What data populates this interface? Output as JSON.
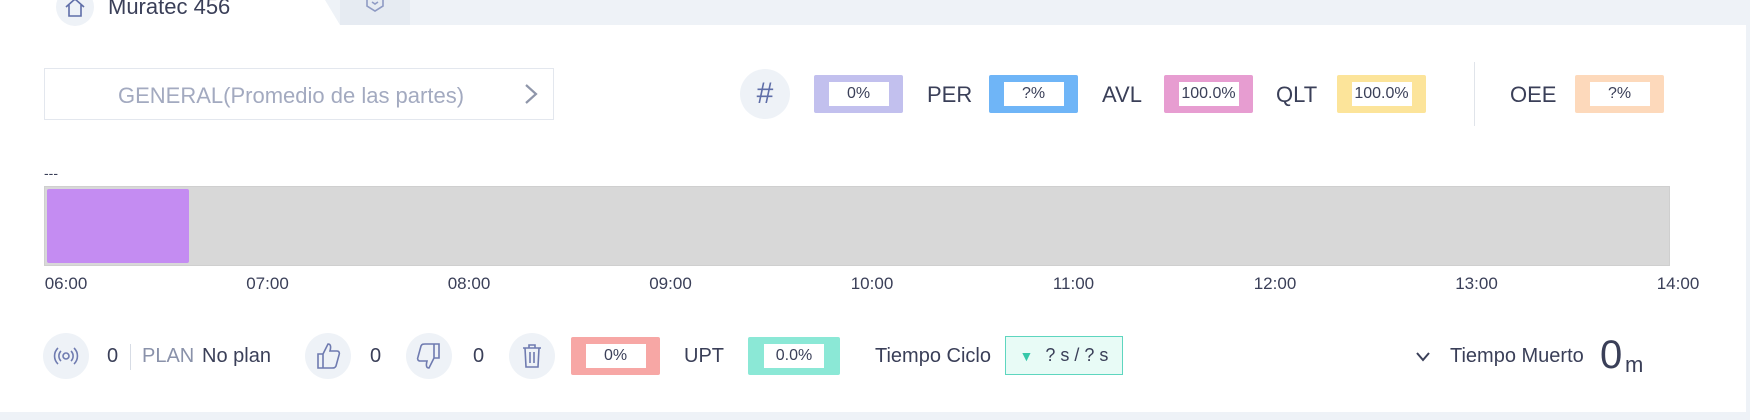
{
  "tabs": [
    {
      "label": "Muratec 456",
      "icon": "home-icon"
    },
    {
      "label": "",
      "icon": "hexagon-icon"
    }
  ],
  "selector": {
    "label": "GENERAL(Promedio de las partes)",
    "icon": "chevron-right-icon"
  },
  "kpis": {
    "count": {
      "icon": "hash-icon",
      "symbol": "#",
      "value": "0%",
      "color": "#c2c0ee"
    },
    "per": {
      "label": "PER",
      "value": "?%",
      "color": "#6fb5f7"
    },
    "avl": {
      "label": "AVL",
      "value": "100.0%",
      "color": "#e79dd1"
    },
    "qlt": {
      "label": "QLT",
      "value": "100.0%",
      "color": "#fce49a"
    },
    "oee": {
      "label": "OEE",
      "value": "?%",
      "color": "#fdd9bb"
    }
  },
  "timeline": {
    "label": "---",
    "start": "06:00",
    "end": "14:00",
    "ticks": [
      "06:00",
      "07:00",
      "08:00",
      "09:00",
      "10:00",
      "11:00",
      "12:00",
      "13:00",
      "14:00"
    ],
    "segments": [
      {
        "from": "06:00",
        "to": "06:42",
        "color": "#c48cf2"
      }
    ]
  },
  "bottom": {
    "signal": {
      "icon": "signal-icon",
      "value": "0"
    },
    "plan": {
      "label": "PLAN",
      "value": "No plan"
    },
    "good": {
      "icon": "thumbs-up-icon",
      "value": "0"
    },
    "bad": {
      "icon": "thumbs-down-icon",
      "value": "0"
    },
    "scrap": {
      "icon": "trash-icon",
      "value": "0%",
      "color": "#f7a7a5"
    },
    "upt": {
      "label": "UPT",
      "value": "0.0%",
      "color": "#8be8d6"
    },
    "cycle": {
      "label": "Tiempo Ciclo",
      "value": "? s / ? s",
      "icon": "triangle-down-icon"
    },
    "dead": {
      "label": "Tiempo Muerto",
      "value": "0",
      "unit": "m",
      "icon": "chevron-down-icon"
    }
  }
}
